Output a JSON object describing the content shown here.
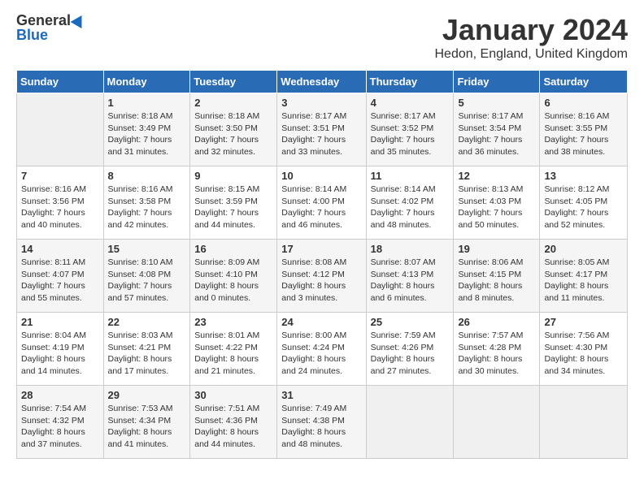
{
  "header": {
    "logo_general": "General",
    "logo_blue": "Blue",
    "month_title": "January 2024",
    "location": "Hedon, England, United Kingdom"
  },
  "days_of_week": [
    "Sunday",
    "Monday",
    "Tuesday",
    "Wednesday",
    "Thursday",
    "Friday",
    "Saturday"
  ],
  "weeks": [
    [
      {
        "day": "",
        "content": ""
      },
      {
        "day": "1",
        "content": "Sunrise: 8:18 AM\nSunset: 3:49 PM\nDaylight: 7 hours\nand 31 minutes."
      },
      {
        "day": "2",
        "content": "Sunrise: 8:18 AM\nSunset: 3:50 PM\nDaylight: 7 hours\nand 32 minutes."
      },
      {
        "day": "3",
        "content": "Sunrise: 8:17 AM\nSunset: 3:51 PM\nDaylight: 7 hours\nand 33 minutes."
      },
      {
        "day": "4",
        "content": "Sunrise: 8:17 AM\nSunset: 3:52 PM\nDaylight: 7 hours\nand 35 minutes."
      },
      {
        "day": "5",
        "content": "Sunrise: 8:17 AM\nSunset: 3:54 PM\nDaylight: 7 hours\nand 36 minutes."
      },
      {
        "day": "6",
        "content": "Sunrise: 8:16 AM\nSunset: 3:55 PM\nDaylight: 7 hours\nand 38 minutes."
      }
    ],
    [
      {
        "day": "7",
        "content": "Sunrise: 8:16 AM\nSunset: 3:56 PM\nDaylight: 7 hours\nand 40 minutes."
      },
      {
        "day": "8",
        "content": "Sunrise: 8:16 AM\nSunset: 3:58 PM\nDaylight: 7 hours\nand 42 minutes."
      },
      {
        "day": "9",
        "content": "Sunrise: 8:15 AM\nSunset: 3:59 PM\nDaylight: 7 hours\nand 44 minutes."
      },
      {
        "day": "10",
        "content": "Sunrise: 8:14 AM\nSunset: 4:00 PM\nDaylight: 7 hours\nand 46 minutes."
      },
      {
        "day": "11",
        "content": "Sunrise: 8:14 AM\nSunset: 4:02 PM\nDaylight: 7 hours\nand 48 minutes."
      },
      {
        "day": "12",
        "content": "Sunrise: 8:13 AM\nSunset: 4:03 PM\nDaylight: 7 hours\nand 50 minutes."
      },
      {
        "day": "13",
        "content": "Sunrise: 8:12 AM\nSunset: 4:05 PM\nDaylight: 7 hours\nand 52 minutes."
      }
    ],
    [
      {
        "day": "14",
        "content": "Sunrise: 8:11 AM\nSunset: 4:07 PM\nDaylight: 7 hours\nand 55 minutes."
      },
      {
        "day": "15",
        "content": "Sunrise: 8:10 AM\nSunset: 4:08 PM\nDaylight: 7 hours\nand 57 minutes."
      },
      {
        "day": "16",
        "content": "Sunrise: 8:09 AM\nSunset: 4:10 PM\nDaylight: 8 hours\nand 0 minutes."
      },
      {
        "day": "17",
        "content": "Sunrise: 8:08 AM\nSunset: 4:12 PM\nDaylight: 8 hours\nand 3 minutes."
      },
      {
        "day": "18",
        "content": "Sunrise: 8:07 AM\nSunset: 4:13 PM\nDaylight: 8 hours\nand 6 minutes."
      },
      {
        "day": "19",
        "content": "Sunrise: 8:06 AM\nSunset: 4:15 PM\nDaylight: 8 hours\nand 8 minutes."
      },
      {
        "day": "20",
        "content": "Sunrise: 8:05 AM\nSunset: 4:17 PM\nDaylight: 8 hours\nand 11 minutes."
      }
    ],
    [
      {
        "day": "21",
        "content": "Sunrise: 8:04 AM\nSunset: 4:19 PM\nDaylight: 8 hours\nand 14 minutes."
      },
      {
        "day": "22",
        "content": "Sunrise: 8:03 AM\nSunset: 4:21 PM\nDaylight: 8 hours\nand 17 minutes."
      },
      {
        "day": "23",
        "content": "Sunrise: 8:01 AM\nSunset: 4:22 PM\nDaylight: 8 hours\nand 21 minutes."
      },
      {
        "day": "24",
        "content": "Sunrise: 8:00 AM\nSunset: 4:24 PM\nDaylight: 8 hours\nand 24 minutes."
      },
      {
        "day": "25",
        "content": "Sunrise: 7:59 AM\nSunset: 4:26 PM\nDaylight: 8 hours\nand 27 minutes."
      },
      {
        "day": "26",
        "content": "Sunrise: 7:57 AM\nSunset: 4:28 PM\nDaylight: 8 hours\nand 30 minutes."
      },
      {
        "day": "27",
        "content": "Sunrise: 7:56 AM\nSunset: 4:30 PM\nDaylight: 8 hours\nand 34 minutes."
      }
    ],
    [
      {
        "day": "28",
        "content": "Sunrise: 7:54 AM\nSunset: 4:32 PM\nDaylight: 8 hours\nand 37 minutes."
      },
      {
        "day": "29",
        "content": "Sunrise: 7:53 AM\nSunset: 4:34 PM\nDaylight: 8 hours\nand 41 minutes."
      },
      {
        "day": "30",
        "content": "Sunrise: 7:51 AM\nSunset: 4:36 PM\nDaylight: 8 hours\nand 44 minutes."
      },
      {
        "day": "31",
        "content": "Sunrise: 7:49 AM\nSunset: 4:38 PM\nDaylight: 8 hours\nand 48 minutes."
      },
      {
        "day": "",
        "content": ""
      },
      {
        "day": "",
        "content": ""
      },
      {
        "day": "",
        "content": ""
      }
    ]
  ]
}
